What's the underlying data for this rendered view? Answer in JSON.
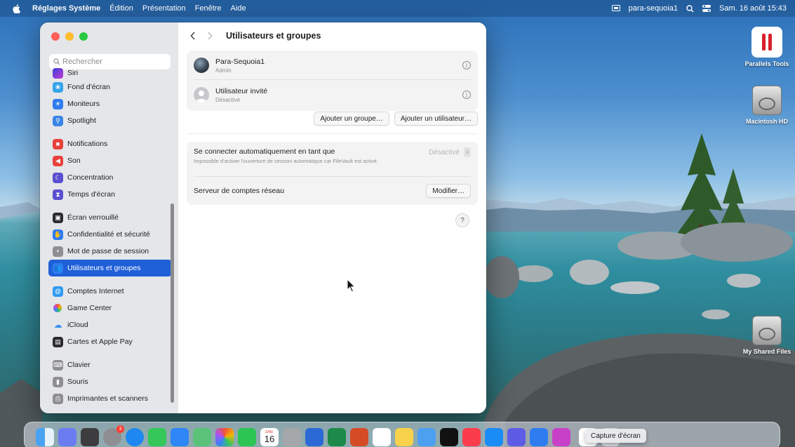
{
  "menubar": {
    "app_name": "Réglages Système",
    "menus": [
      "Édition",
      "Présentation",
      "Fenêtre",
      "Aide"
    ],
    "user": "para-sequoia1",
    "datetime": "Sam. 16 août 15:43"
  },
  "desktop": {
    "icons": [
      {
        "label": "Parallels Tools"
      },
      {
        "label": "Macintosh HD"
      },
      {
        "label": "My Shared Files"
      }
    ]
  },
  "sidebar": {
    "search_placeholder": "Rechercher",
    "items": [
      {
        "label": "Siri",
        "icon": "siri-icon",
        "color": "#4a5bd6"
      },
      {
        "label": "Fond d'écran",
        "icon": "wallpaper-icon",
        "color": "#35a4e8"
      },
      {
        "label": "Moniteurs",
        "icon": "displays-icon",
        "color": "#2f7cf0"
      },
      {
        "label": "Spotlight",
        "icon": "spotlight-icon",
        "color": "#3a84e8"
      },
      {
        "label": "Notifications",
        "icon": "notifications-icon",
        "color": "#e8403a"
      },
      {
        "label": "Son",
        "icon": "sound-icon",
        "color": "#e8403a"
      },
      {
        "label": "Concentration",
        "icon": "focus-icon",
        "color": "#5a4fd0"
      },
      {
        "label": "Temps d'écran",
        "icon": "screen-time-icon",
        "color": "#5a4fd0"
      },
      {
        "label": "Écran verrouillé",
        "icon": "lock-screen-icon",
        "color": "#2b2b2d"
      },
      {
        "label": "Confidentialité et sécurité",
        "icon": "privacy-icon",
        "color": "#2f7cf0"
      },
      {
        "label": "Mot de passe de session",
        "icon": "password-icon",
        "color": "#8e8e93"
      },
      {
        "label": "Utilisateurs et groupes",
        "icon": "users-icon",
        "color": "#2f7cf0"
      },
      {
        "label": "Comptes Internet",
        "icon": "internet-accounts-icon",
        "color": "#2f9af0"
      },
      {
        "label": "Game Center",
        "icon": "game-center-icon",
        "color": "#ffffff"
      },
      {
        "label": "iCloud",
        "icon": "icloud-icon",
        "color": "#ffffff"
      },
      {
        "label": "Cartes et Apple Pay",
        "icon": "wallet-icon",
        "color": "#2b2b2d"
      },
      {
        "label": "Clavier",
        "icon": "keyboard-icon",
        "color": "#8e8e93"
      },
      {
        "label": "Souris",
        "icon": "mouse-icon",
        "color": "#8e8e93"
      },
      {
        "label": "Imprimantes et scanners",
        "icon": "printer-icon",
        "color": "#8e8e93"
      }
    ],
    "active_label": "Utilisateurs et groupes"
  },
  "content": {
    "title": "Utilisateurs et groupes",
    "users": [
      {
        "name": "Para-Sequoia1",
        "role": "Admin"
      },
      {
        "name": "Utilisateur invité",
        "role": "Désactivé"
      }
    ],
    "add_group_label": "Ajouter un groupe…",
    "add_user_label": "Ajouter un utilisateur…",
    "auto_login": {
      "label": "Se connecter automatiquement en tant que",
      "description": "Impossible d'activer l'ouverture de session automatique car FileVault est activé.",
      "value": "Désactivé"
    },
    "network_server": {
      "label": "Serveur de comptes réseau",
      "button": "Modifier…"
    },
    "help_label": "?"
  },
  "dock": {
    "tooltip": "Capture d'écran",
    "calendar_month": "SAM.",
    "calendar_day": "16",
    "badge_count": "3"
  },
  "colors": {
    "accent": "#1f5fd8",
    "close": "#ff5f57",
    "minimize": "#febc2e",
    "zoom": "#28c840"
  }
}
